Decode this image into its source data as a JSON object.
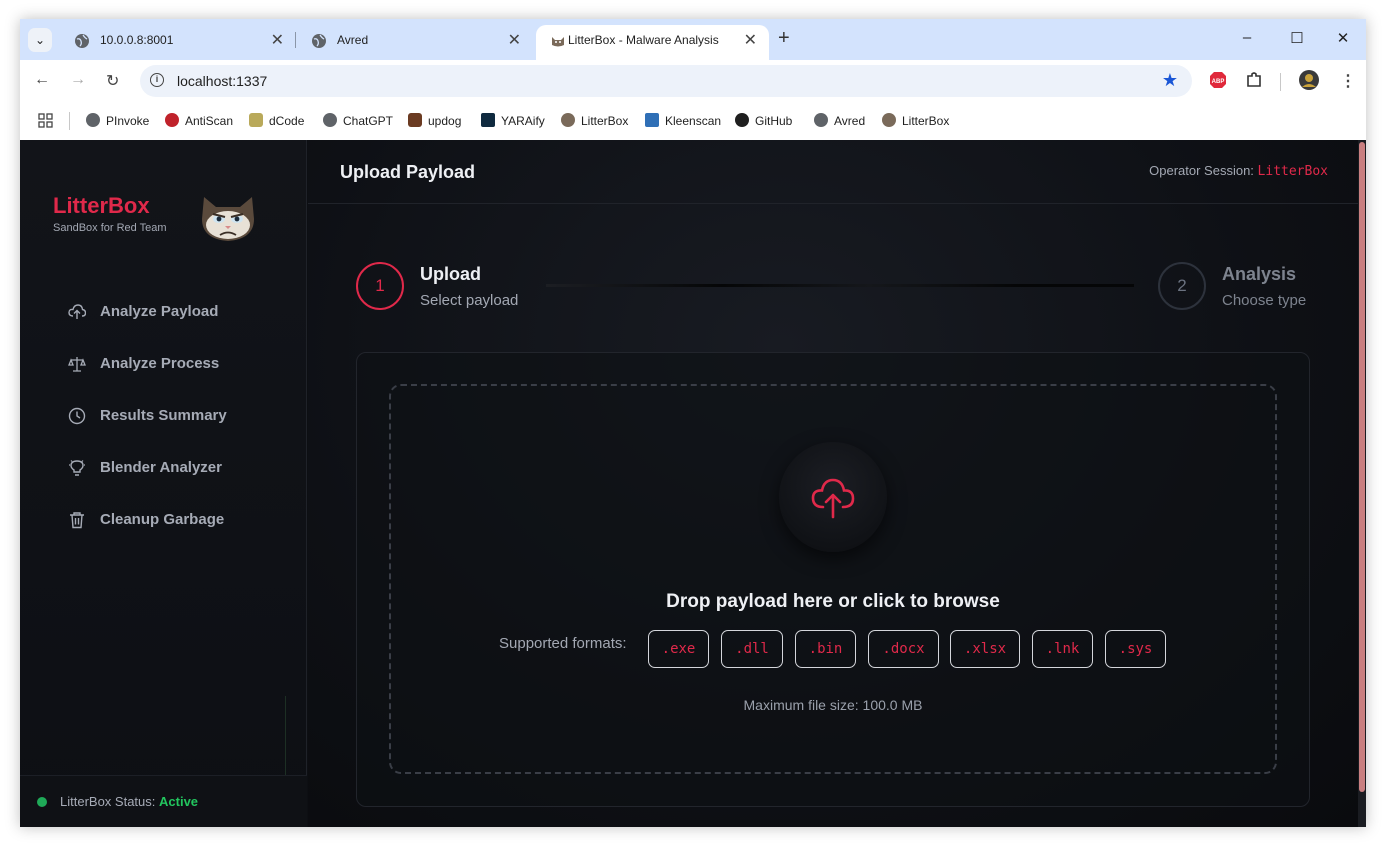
{
  "browser": {
    "tabs": [
      {
        "title": "10.0.0.8:8001",
        "close": "✕"
      },
      {
        "title": "Avred",
        "close": "✕"
      },
      {
        "title": "LitterBox - Malware Analysis",
        "close": "✕"
      }
    ],
    "new_tab": "+",
    "window_controls": {
      "minimize": "–",
      "maximize": "☐",
      "close": "✕"
    },
    "url": "localhost:1337",
    "bookmarks": [
      "PInvoke",
      "AntiScan",
      "dCode",
      "ChatGPT",
      "updog",
      "YARAify",
      "LitterBox",
      "Kleenscan",
      "GitHub",
      "Avred",
      "LitterBox"
    ]
  },
  "sidebar": {
    "brand": "LitterBox",
    "subtitle": "SandBox for Red Team",
    "items": [
      {
        "label": "Analyze Payload",
        "icon": "cloud-upload-icon"
      },
      {
        "label": "Analyze Process",
        "icon": "scale-icon"
      },
      {
        "label": "Results Summary",
        "icon": "clock-icon"
      },
      {
        "label": "Blender Analyzer",
        "icon": "bulb-icon"
      },
      {
        "label": "Cleanup Garbage",
        "icon": "trash-icon"
      }
    ],
    "status_label": "LitterBox Status:",
    "status_value": "Active"
  },
  "header": {
    "title": "Upload Payload",
    "session_label": "Operator Session:",
    "session_value": "LitterBox"
  },
  "steps": [
    {
      "number": "1",
      "title": "Upload",
      "subtitle": "Select payload",
      "state": "active"
    },
    {
      "number": "2",
      "title": "Analysis",
      "subtitle": "Choose type",
      "state": "inactive"
    }
  ],
  "upload": {
    "prompt": "Drop payload here or click to browse",
    "formats_label": "Supported formats:",
    "formats": [
      ".exe",
      ".dll",
      ".bin",
      ".docx",
      ".xlsx",
      ".lnk",
      ".sys"
    ],
    "max_size": "Maximum file size: 100.0 MB"
  },
  "colors": {
    "accent": "#e0294a",
    "active_status": "#22c55e",
    "background": "#0d0f13"
  }
}
